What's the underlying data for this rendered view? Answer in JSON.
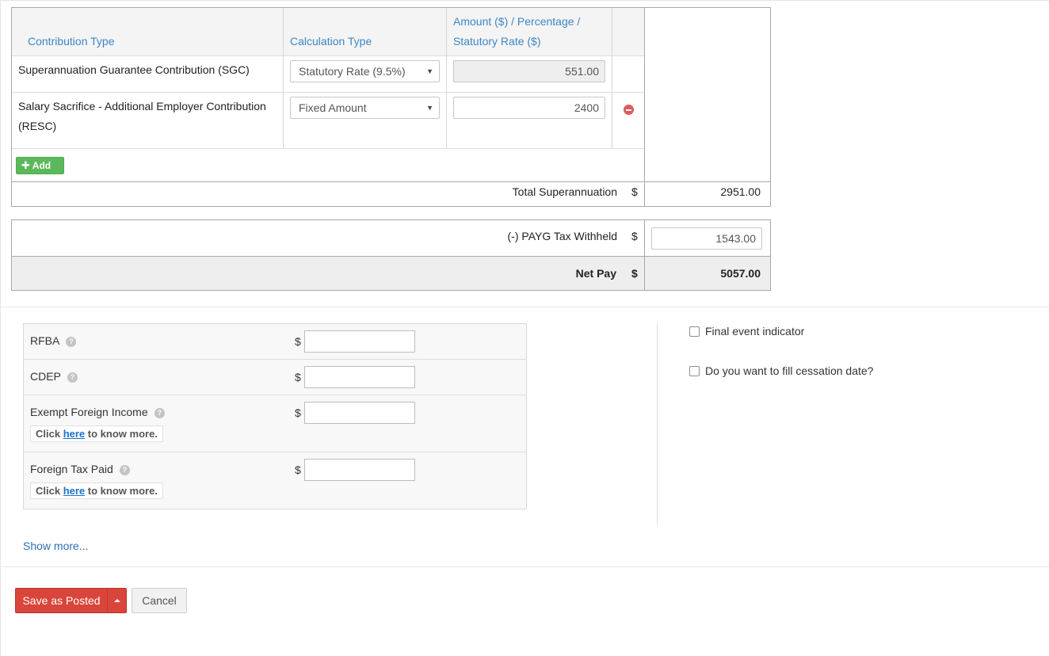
{
  "superannuation": {
    "headers": {
      "contribution_type": "Contribution Type",
      "calculation_type": "Calculation Type",
      "amount_line1": "Amount ($) / Percentage /",
      "amount_line2": "Statutory Rate ($)"
    },
    "rows": [
      {
        "contribution_type": "Superannuation Guarantee Contribution (SGC)",
        "calculation_type": "Statutory Rate (9.5%)",
        "amount": "551.00"
      },
      {
        "contribution_type_line1": "Salary Sacrifice - Additional Employer Contribution",
        "contribution_type_line2": "(RESC)",
        "calculation_type": "Fixed Amount",
        "amount": "2400"
      }
    ],
    "add_label": "Add",
    "total_label": "Total Superannuation",
    "currency": "$",
    "total_value": "2951.00"
  },
  "payg": {
    "label": "(-) PAYG Tax Withheld",
    "currency": "$",
    "value": "1543.00"
  },
  "net_pay": {
    "label": "Net Pay",
    "currency": "$",
    "value": "5057.00"
  },
  "extra_fields": {
    "rfba_label": "RFBA",
    "cdep_label": "CDEP",
    "exempt_label": "Exempt Foreign Income",
    "foreign_tax_label": "Foreign Tax Paid",
    "currency": "$",
    "tip_prefix": "Click",
    "tip_link": "here",
    "tip_suffix": "to know more.",
    "help_glyph": "?"
  },
  "options": {
    "final_event": "Final event indicator",
    "cessation": "Do you want to fill cessation date?"
  },
  "show_more": "Show more...",
  "actions": {
    "save": "Save as Posted",
    "cancel": "Cancel"
  },
  "colors": {
    "header_text": "#3d86c6",
    "save_button": "#d9453a",
    "add_button": "#5cb85c",
    "remove_icon": "#e05a5a"
  },
  "icons": [
    "plus-icon",
    "dropdown-caret-icon",
    "remove-circle-icon",
    "help-circle-icon"
  ]
}
